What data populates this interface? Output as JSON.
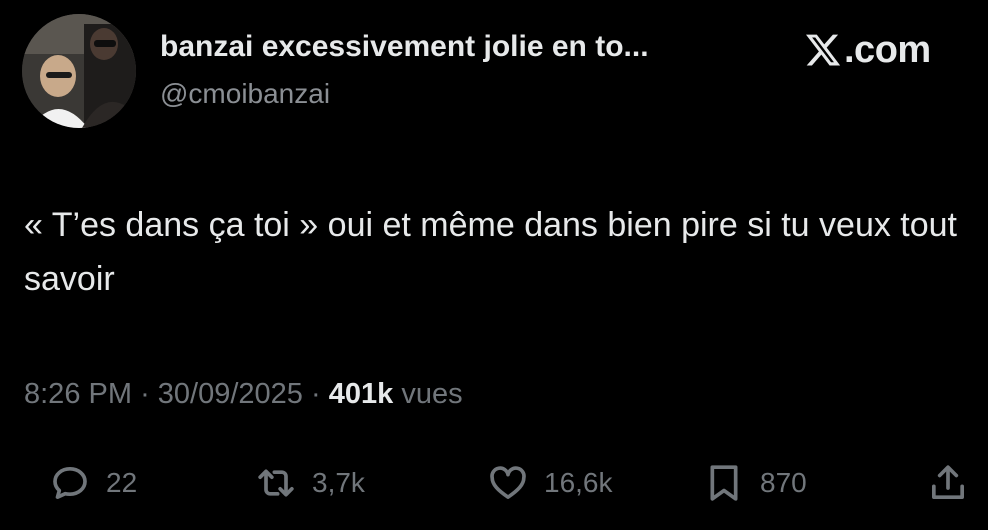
{
  "author": {
    "display_name": "banzai excessivement jolie en to...",
    "handle": "@cmoibanzai"
  },
  "brand": {
    "icon": "x-logo-icon",
    "suffix": ".com"
  },
  "tweet": {
    "text": "« T’es dans ça toi » oui et même dans bien pire si tu veux tout savoir",
    "time": "8:26 PM",
    "separator": "·",
    "date": "30/09/2025",
    "views_count": "401k",
    "views_label": "vues"
  },
  "actions": {
    "reply": {
      "icon": "reply-icon",
      "count": "22"
    },
    "repost": {
      "icon": "repost-icon",
      "count": "3,7k"
    },
    "like": {
      "icon": "heart-icon",
      "count": "16,6k"
    },
    "bookmark": {
      "icon": "bookmark-icon",
      "count": "870"
    },
    "share": {
      "icon": "share-icon"
    }
  },
  "colors": {
    "background": "#000000",
    "primary_text": "#e7e9ea",
    "secondary_text": "#71767b"
  }
}
